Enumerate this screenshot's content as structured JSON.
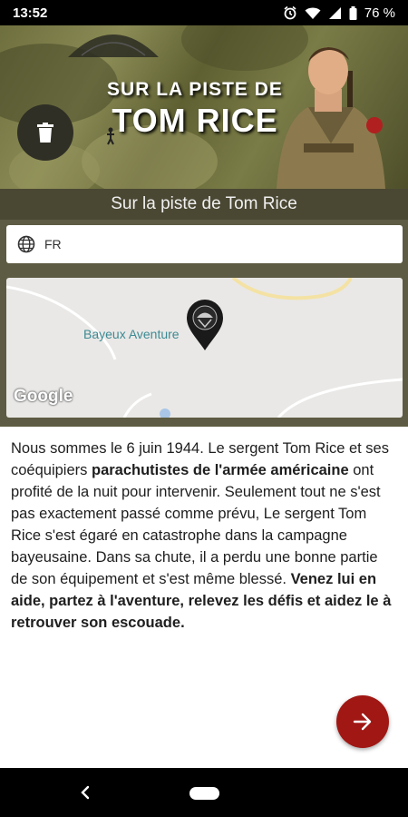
{
  "status_bar": {
    "time": "13:52",
    "battery": "76 %",
    "icons": [
      "alarm-icon",
      "wifi-icon",
      "signal-icon",
      "battery-icon"
    ]
  },
  "banner": {
    "title_line1": "SUR LA PISTE DE",
    "title_line2": "TOM RICE",
    "delete_icon": "trash-icon"
  },
  "header": {
    "subtitle": "Sur la piste de Tom Rice"
  },
  "language": {
    "icon": "globe-icon",
    "value": "FR"
  },
  "map": {
    "place_label": "Bayeux Aventure",
    "marker_icon": "paratrooper-marker-icon",
    "attribution": "Google"
  },
  "description": {
    "p1": "Nous sommes le 6 juin 1944. Le sergent Tom Rice et ses coéquipiers ",
    "b1": "parachutistes de l'armée américaine",
    "p2": " ont profité de la nuit pour intervenir. Seulement tout ne s'est pas exactement passé comme prévu, Le sergent Tom Rice s'est égaré en catastrophe dans la campagne bayeusaine. Dans sa chute, il a perdu une bonne partie de son équipement et s'est même blessé. ",
    "b2": "Venez lui en aide, partez à l'aventure, relevez les défis et aidez le à retrouver son escouade."
  },
  "actions": {
    "next_icon": "arrow-right-icon"
  },
  "colors": {
    "accent_red": "#a01714",
    "olive_bar": "#4a4833",
    "background": "#5d5b43"
  }
}
